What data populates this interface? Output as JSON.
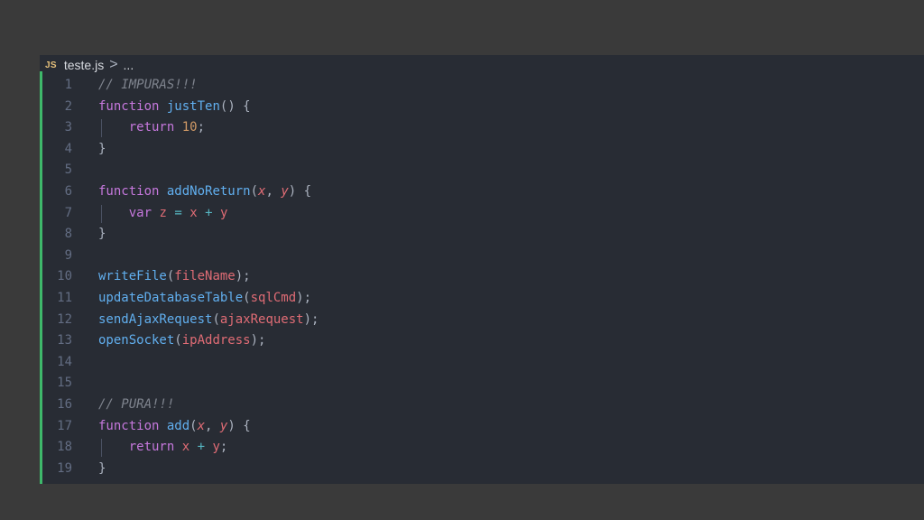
{
  "breadcrumb": {
    "icon_label": "JS",
    "file": "teste.js",
    "separator": ">",
    "ellipsis": "..."
  },
  "colors": {
    "window_background": "#3a3a3a",
    "editor_background": "#282c34",
    "modified_gutter": "#3eb86a"
  },
  "lines": [
    {
      "n": "1",
      "tokens": [
        {
          "t": "// IMPURAS!!!",
          "c": "comment"
        }
      ]
    },
    {
      "n": "2",
      "tokens": [
        {
          "t": "function",
          "c": "keyword"
        },
        {
          "t": " ",
          "c": "plain"
        },
        {
          "t": "justTen",
          "c": "function"
        },
        {
          "t": "() {",
          "c": "punct"
        }
      ]
    },
    {
      "n": "3",
      "guide": true,
      "tokens": [
        {
          "t": "    ",
          "c": "plain"
        },
        {
          "t": "return",
          "c": "keyword"
        },
        {
          "t": " ",
          "c": "plain"
        },
        {
          "t": "10",
          "c": "number"
        },
        {
          "t": ";",
          "c": "punct"
        }
      ]
    },
    {
      "n": "4",
      "tokens": [
        {
          "t": "}",
          "c": "punct"
        }
      ]
    },
    {
      "n": "5",
      "tokens": []
    },
    {
      "n": "6",
      "tokens": [
        {
          "t": "function",
          "c": "keyword"
        },
        {
          "t": " ",
          "c": "plain"
        },
        {
          "t": "addNoReturn",
          "c": "function"
        },
        {
          "t": "(",
          "c": "punct"
        },
        {
          "t": "x",
          "c": "param"
        },
        {
          "t": ", ",
          "c": "punct"
        },
        {
          "t": "y",
          "c": "param"
        },
        {
          "t": ") {",
          "c": "punct"
        }
      ]
    },
    {
      "n": "7",
      "guide": true,
      "tokens": [
        {
          "t": "    ",
          "c": "plain"
        },
        {
          "t": "var",
          "c": "keyword"
        },
        {
          "t": " ",
          "c": "plain"
        },
        {
          "t": "z",
          "c": "variable"
        },
        {
          "t": " ",
          "c": "plain"
        },
        {
          "t": "=",
          "c": "operator"
        },
        {
          "t": " ",
          "c": "plain"
        },
        {
          "t": "x",
          "c": "variable"
        },
        {
          "t": " ",
          "c": "plain"
        },
        {
          "t": "+",
          "c": "operator"
        },
        {
          "t": " ",
          "c": "plain"
        },
        {
          "t": "y",
          "c": "variable"
        }
      ]
    },
    {
      "n": "8",
      "tokens": [
        {
          "t": "}",
          "c": "punct"
        }
      ]
    },
    {
      "n": "9",
      "tokens": []
    },
    {
      "n": "10",
      "tokens": [
        {
          "t": "writeFile",
          "c": "function"
        },
        {
          "t": "(",
          "c": "punct"
        },
        {
          "t": "fileName",
          "c": "variable"
        },
        {
          "t": ");",
          "c": "punct"
        }
      ]
    },
    {
      "n": "11",
      "tokens": [
        {
          "t": "updateDatabaseTable",
          "c": "function"
        },
        {
          "t": "(",
          "c": "punct"
        },
        {
          "t": "sqlCmd",
          "c": "variable"
        },
        {
          "t": ");",
          "c": "punct"
        }
      ]
    },
    {
      "n": "12",
      "tokens": [
        {
          "t": "sendAjaxRequest",
          "c": "function"
        },
        {
          "t": "(",
          "c": "punct"
        },
        {
          "t": "ajaxRequest",
          "c": "variable"
        },
        {
          "t": ");",
          "c": "punct"
        }
      ]
    },
    {
      "n": "13",
      "tokens": [
        {
          "t": "openSocket",
          "c": "function"
        },
        {
          "t": "(",
          "c": "punct"
        },
        {
          "t": "ipAddress",
          "c": "variable"
        },
        {
          "t": ");",
          "c": "punct"
        }
      ]
    },
    {
      "n": "14",
      "tokens": []
    },
    {
      "n": "15",
      "tokens": []
    },
    {
      "n": "16",
      "tokens": [
        {
          "t": "// PURA!!!",
          "c": "comment"
        }
      ]
    },
    {
      "n": "17",
      "tokens": [
        {
          "t": "function",
          "c": "keyword"
        },
        {
          "t": " ",
          "c": "plain"
        },
        {
          "t": "add",
          "c": "function"
        },
        {
          "t": "(",
          "c": "punct"
        },
        {
          "t": "x",
          "c": "param"
        },
        {
          "t": ", ",
          "c": "punct"
        },
        {
          "t": "y",
          "c": "param"
        },
        {
          "t": ") {",
          "c": "punct"
        }
      ]
    },
    {
      "n": "18",
      "guide": true,
      "tokens": [
        {
          "t": "    ",
          "c": "plain"
        },
        {
          "t": "return",
          "c": "keyword"
        },
        {
          "t": " ",
          "c": "plain"
        },
        {
          "t": "x",
          "c": "variable"
        },
        {
          "t": " ",
          "c": "plain"
        },
        {
          "t": "+",
          "c": "operator"
        },
        {
          "t": " ",
          "c": "plain"
        },
        {
          "t": "y",
          "c": "variable"
        },
        {
          "t": ";",
          "c": "punct"
        }
      ]
    },
    {
      "n": "19",
      "tokens": [
        {
          "t": "}",
          "c": "punct"
        }
      ]
    }
  ]
}
